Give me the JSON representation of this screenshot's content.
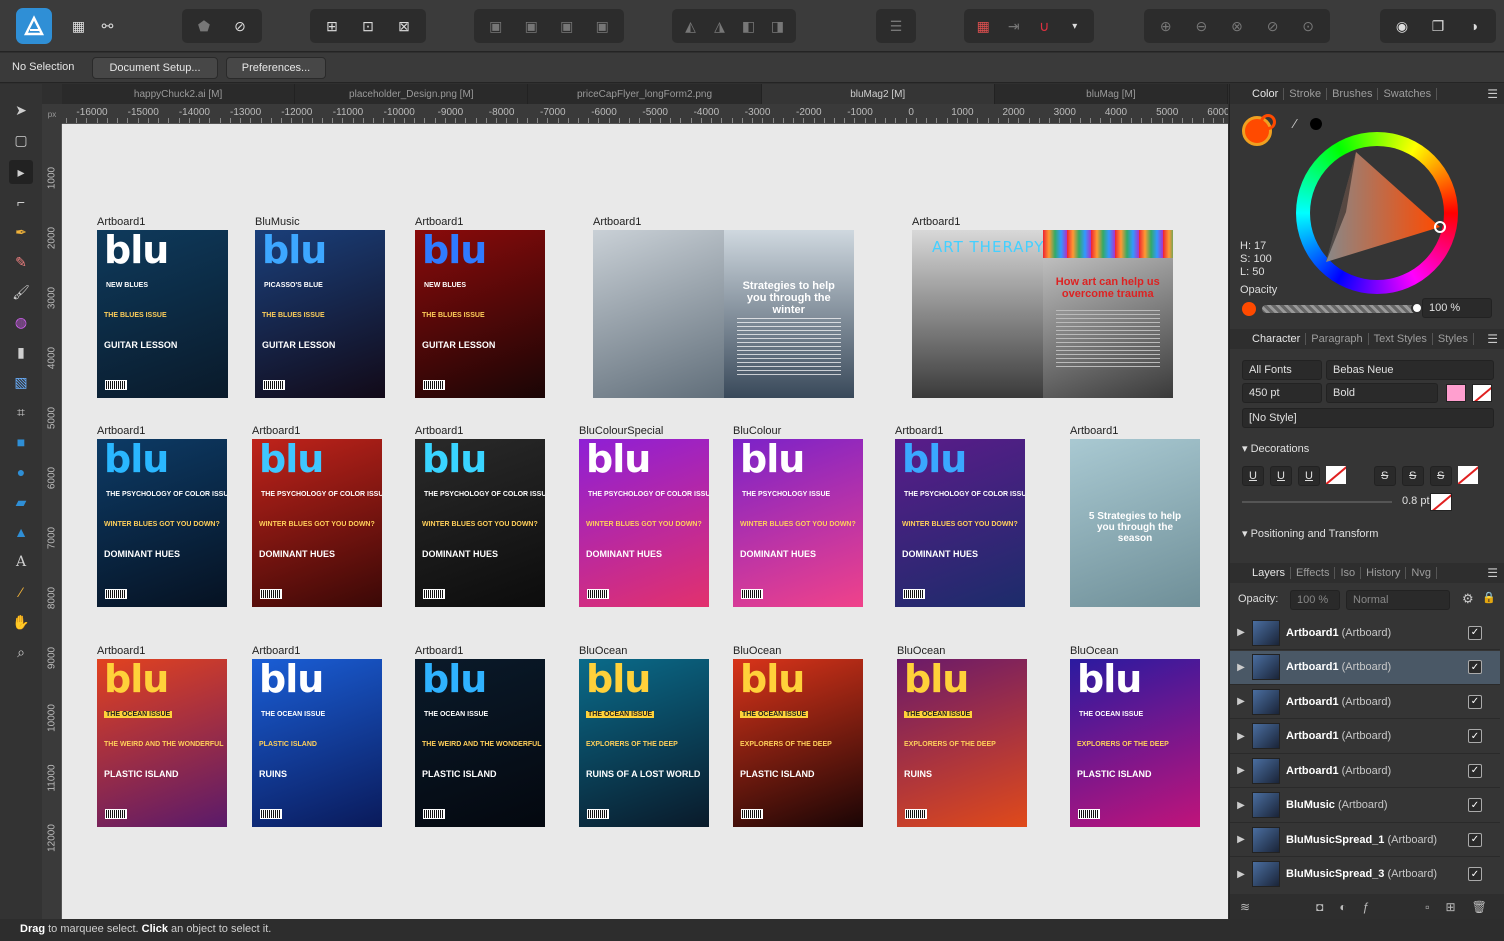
{
  "app": {
    "name": "Affinity Designer"
  },
  "context_bar": {
    "status": "No Selection",
    "document_setup": "Document Setup...",
    "preferences": "Preferences..."
  },
  "doc_tabs": [
    {
      "label": "happyChuck2.ai [M]",
      "active": false
    },
    {
      "label": "placeholder_Design.png [M]",
      "active": false
    },
    {
      "label": "priceCapFlyer_longForm2.png",
      "active": false
    },
    {
      "label": "bluMag2 [M]",
      "active": true
    },
    {
      "label": "bluMag [M]",
      "active": false
    }
  ],
  "ruler": {
    "unit": "px",
    "h_ticks": [
      "-16000",
      "-15000",
      "-14000",
      "-13000",
      "-12000",
      "-11000",
      "-10000",
      "-9000",
      "-8000",
      "-7000",
      "-6000",
      "-5000",
      "-4000",
      "-3000",
      "-2000",
      "-1000",
      "0",
      "1000",
      "2000",
      "3000",
      "4000",
      "5000",
      "6000"
    ],
    "v_ticks": [
      "1000",
      "2000",
      "3000",
      "4000",
      "5000",
      "6000",
      "7000",
      "8000",
      "9000",
      "10000",
      "11000",
      "12000"
    ]
  },
  "artboards": [
    {
      "label": "Artboard1",
      "mast": "blu",
      "line1": "NEW BLUES",
      "line2": "THE BLUES ISSUE",
      "line3": "GUITAR LESSON",
      "bg": [
        "#0e3a5c",
        "#0a1a2a"
      ],
      "mast_color": "#ffffff"
    },
    {
      "label": "BluMusic",
      "mast": "blu",
      "line1": "PICASSO'S BLUE",
      "line2": "THE BLUES ISSUE",
      "line3": "GUITAR LESSON",
      "bg": [
        "#1a3f7a",
        "#120a18"
      ],
      "mast_color": "#3da7ff"
    },
    {
      "label": "Artboard1",
      "mast": "blu",
      "line1": "NEW BLUES",
      "line2": "THE BLUES ISSUE",
      "line3": "GUITAR LESSON",
      "bg": [
        "#8a0b0b",
        "#1a0505"
      ],
      "mast_color": "#2f7bff"
    },
    {
      "label": "Artboard1",
      "mast": "",
      "line1": "Strategies to help you through the winter",
      "line2": "",
      "line3": "",
      "bg": [
        "#c9d0d6",
        "#4a5966"
      ],
      "mast_color": "#ffffff"
    },
    {
      "label": "Artboard1",
      "mast": "ART THERAPY",
      "line1": "How art can help us overcome trauma",
      "line2": "",
      "line3": "",
      "bg": [
        "#f4f4f4",
        "#3a3a3a"
      ],
      "mast_color": "#45d0ff"
    },
    {
      "label": "Artboard1",
      "mast": "blu",
      "line1": "THE PSYCHOLOGY OF COLOR ISSUE",
      "line2": "WINTER BLUES GOT YOU DOWN?",
      "line3": "DOMINANT HUES",
      "bg": [
        "#0d3b66",
        "#061222"
      ],
      "mast_color": "#2ab7ff"
    },
    {
      "label": "Artboard1",
      "mast": "blu",
      "line1": "THE PSYCHOLOGY OF COLOR ISSUE",
      "line2": "WINTER BLUES GOT YOU DOWN?",
      "line3": "DOMINANT HUES",
      "bg": [
        "#c0231b",
        "#3a0806"
      ],
      "mast_color": "#3fc6ff"
    },
    {
      "label": "Artboard1",
      "mast": "blu",
      "line1": "THE PSYCHOLOGY OF COLOR ISSUE",
      "line2": "WINTER BLUES GOT YOU DOWN?",
      "line3": "DOMINANT HUES",
      "bg": [
        "#2a2a2a",
        "#0c0c0c"
      ],
      "mast_color": "#39d4ff"
    },
    {
      "label": "BluColourSpecial",
      "mast": "blu",
      "line1": "THE PSYCHOLOGY OF COLOR ISSUE",
      "line2": "WINTER BLUES GOT YOU DOWN?",
      "line3": "DOMINANT HUES",
      "bg": [
        "#8e1fd6",
        "#e2316d"
      ],
      "mast_color": "#ffffff"
    },
    {
      "label": "BluColour",
      "mast": "blu",
      "line1": "THE PSYCHOLOGY ISSUE",
      "line2": "WINTER BLUES GOT YOU DOWN?",
      "line3": "DOMINANT HUES",
      "bg": [
        "#7b22c9",
        "#f0428a"
      ],
      "mast_color": "#ffffff"
    },
    {
      "label": "Artboard1",
      "mast": "blu",
      "line1": "THE PSYCHOLOGY OF COLOR ISSUE",
      "line2": "WINTER BLUES GOT YOU DOWN?",
      "line3": "DOMINANT HUES",
      "bg": [
        "#5a1c8a",
        "#1c2c6a"
      ],
      "mast_color": "#3aa8ff"
    },
    {
      "label": "Artboard1",
      "mast": "",
      "line1": "5 Strategies to help you through the season",
      "line2": "",
      "line3": "",
      "bg": [
        "#a9c9d2",
        "#6f8f98"
      ],
      "mast_color": "#ffffff"
    },
    {
      "label": "Artboard1",
      "mast": "blu",
      "line1": "THE OCEAN ISSUE",
      "line2": "THE WEIRD AND THE WONDERFUL",
      "line3": "PLASTIC ISLAND",
      "bg": [
        "#e2421f",
        "#5a1a6a"
      ],
      "mast_color": "#ffd13a"
    },
    {
      "label": "Artboard1",
      "mast": "blu",
      "line1": "THE OCEAN ISSUE",
      "line2": "PLASTIC ISLAND",
      "line3": "RUINS",
      "bg": [
        "#1a5ed6",
        "#0a1a5a"
      ],
      "mast_color": "#ffffff"
    },
    {
      "label": "Artboard1",
      "mast": "blu",
      "line1": "THE OCEAN ISSUE",
      "line2": "THE WEIRD AND THE WONDERFUL",
      "line3": "PLASTIC ISLAND",
      "bg": [
        "#0a1a2a",
        "#04080f"
      ],
      "mast_color": "#2fb2ff"
    },
    {
      "label": "BluOcean",
      "mast": "blu",
      "line1": "THE OCEAN ISSUE",
      "line2": "EXPLORERS OF THE DEEP",
      "line3": "RUINS OF A LOST WORLD",
      "bg": [
        "#0a6b8a",
        "#0a1a2a"
      ],
      "mast_color": "#ffd13a"
    },
    {
      "label": "BluOcean",
      "mast": "blu",
      "line1": "THE OCEAN ISSUE",
      "line2": "EXPLORERS OF THE DEEP",
      "line3": "PLASTIC ISLAND",
      "bg": [
        "#d9341a",
        "#1a0505"
      ],
      "mast_color": "#ffd13a"
    },
    {
      "label": "BluOcean",
      "mast": "blu",
      "line1": "THE OCEAN ISSUE",
      "line2": "EXPLORERS OF THE DEEP",
      "line3": "RUINS",
      "bg": [
        "#6a1a6a",
        "#e04a1a"
      ],
      "mast_color": "#ffd13a"
    },
    {
      "label": "BluOcean",
      "mast": "blu",
      "line1": "THE OCEAN ISSUE",
      "line2": "EXPLORERS OF THE DEEP",
      "line3": "PLASTIC ISLAND",
      "bg": [
        "#2a1aa0",
        "#c0147a"
      ],
      "mast_color": "#ffffff"
    }
  ],
  "status_bar": {
    "drag": "Drag",
    "drag_text": " to marquee select. ",
    "click": "Click",
    "click_text": " an object to select it."
  },
  "color_panel": {
    "tabs": [
      "Color",
      "Stroke",
      "Brushes",
      "Swatches"
    ],
    "active_tab": "Color",
    "h": "H: 17",
    "s": "S: 100",
    "l": "L: 50",
    "opacity_label": "Opacity",
    "opacity_value": "100 %",
    "fill_color": "#ff4a00"
  },
  "character_panel": {
    "tabs": [
      "Character",
      "Paragraph",
      "Text Styles",
      "Styles"
    ],
    "active_tab": "Character",
    "font_collection": "All Fonts",
    "font_family": "Bebas Neue",
    "font_size": "450 pt",
    "font_weight": "Bold",
    "text_style": "[No Style]",
    "decorations_label": "Decorations",
    "stroke_width": "0.8 pt",
    "positioning_label": "Positioning and Transform",
    "swatch_color": "#ff9fcf"
  },
  "layers_panel": {
    "tabs": [
      "Layers",
      "Effects",
      "Iso",
      "History",
      "Nvg"
    ],
    "active_tab": "Layers",
    "opacity_label": "Opacity:",
    "opacity_value": "100 %",
    "blend_mode": "Normal",
    "rows": [
      {
        "name": "Artboard1",
        "type": "(Artboard)",
        "selected": false
      },
      {
        "name": "Artboard1",
        "type": "(Artboard)",
        "selected": true
      },
      {
        "name": "Artboard1",
        "type": "(Artboard)",
        "selected": false
      },
      {
        "name": "Artboard1",
        "type": "(Artboard)",
        "selected": false
      },
      {
        "name": "Artboard1",
        "type": "(Artboard)",
        "selected": false
      },
      {
        "name": "BluMusic",
        "type": "(Artboard)",
        "selected": false
      },
      {
        "name": "BluMusicSpread_1",
        "type": "(Artboard)",
        "selected": false
      },
      {
        "name": "BluMusicSpread_3",
        "type": "(Artboard)",
        "selected": false
      }
    ]
  }
}
